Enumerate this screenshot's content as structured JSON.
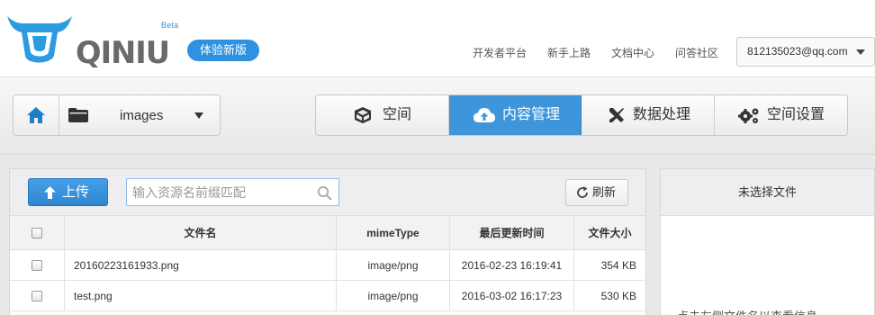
{
  "header": {
    "brand": "QINIU",
    "beta_tag": "Beta",
    "beta_pill": "体验新版",
    "nav": [
      "开发者平台",
      "新手上路",
      "文档中心",
      "问答社区"
    ],
    "account": "812135023@qq.com"
  },
  "breadcrumb": {
    "folder_label": "images"
  },
  "tabs": [
    {
      "label": "空间",
      "icon": "cube-icon",
      "active": false
    },
    {
      "label": "内容管理",
      "icon": "cloud-upload-icon",
      "active": true
    },
    {
      "label": "数据处理",
      "icon": "tools-icon",
      "active": false
    },
    {
      "label": "空间设置",
      "icon": "gears-icon",
      "active": false
    }
  ],
  "toolbar": {
    "upload_label": "上传",
    "search_placeholder": "输入资源名前缀匹配",
    "refresh_label": "刷新"
  },
  "table": {
    "columns": [
      "文件名",
      "mimeType",
      "最后更新时间",
      "文件大小"
    ],
    "rows": [
      {
        "name": "20160223161933.png",
        "mime": "image/png",
        "updated": "2016-02-23 16:19:41",
        "size": "354 KB"
      },
      {
        "name": "test.png",
        "mime": "image/png",
        "updated": "2016-03-02 16:17:23",
        "size": "530 KB"
      }
    ]
  },
  "side": {
    "title": "未选择文件",
    "hint": "点击左侧文件名以查看信息"
  },
  "colors": {
    "accent": "#3e95da",
    "logo_blue": "#2d9be0",
    "logo_gray": "#666666"
  }
}
